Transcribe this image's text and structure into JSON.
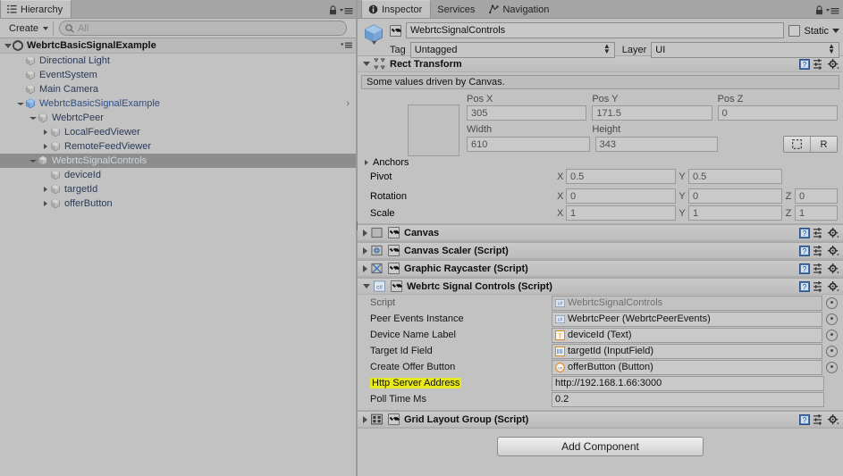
{
  "hierarchy": {
    "tab_label": "Hierarchy",
    "tab_icon": "hierarchy-icon",
    "lock_icon": "lock-icon",
    "menu_icon": "panel-menu-icon",
    "create_label": "Create",
    "search_placeholder": "All",
    "search_value": "",
    "search_icon": "search-icon",
    "scene_root": "WebrtcBasicSignalExample",
    "items": [
      {
        "label": "Directional Light",
        "indent": 1,
        "expander": "none",
        "icon": "gameobject-cube-icon",
        "state": "normal"
      },
      {
        "label": "EventSystem",
        "indent": 1,
        "expander": "none",
        "icon": "gameobject-cube-icon",
        "state": "normal"
      },
      {
        "label": "Main Camera",
        "indent": 1,
        "expander": "none",
        "icon": "gameobject-cube-icon",
        "state": "normal"
      },
      {
        "label": "WebrtcBasicSignalExample",
        "indent": 1,
        "expander": "open",
        "icon": "prefab-cube-icon",
        "state": "prefab"
      },
      {
        "label": "WebrtcPeer",
        "indent": 2,
        "expander": "open",
        "icon": "gameobject-cube-icon",
        "state": "normal"
      },
      {
        "label": "LocalFeedViewer",
        "indent": 3,
        "expander": "closed",
        "icon": "gameobject-cube-icon",
        "state": "normal"
      },
      {
        "label": "RemoteFeedViewer",
        "indent": 3,
        "expander": "closed",
        "icon": "gameobject-cube-icon",
        "state": "normal"
      },
      {
        "label": "WebrtcSignalControls",
        "indent": 2,
        "expander": "open",
        "icon": "gameobject-cube-icon",
        "state": "selected"
      },
      {
        "label": "deviceId",
        "indent": 3,
        "expander": "none",
        "icon": "gameobject-cube-icon",
        "state": "normal"
      },
      {
        "label": "targetId",
        "indent": 3,
        "expander": "closed",
        "icon": "gameobject-cube-icon",
        "state": "normal"
      },
      {
        "label": "offerButton",
        "indent": 3,
        "expander": "closed",
        "icon": "gameobject-cube-icon",
        "state": "normal"
      }
    ]
  },
  "inspector": {
    "tabs": [
      {
        "label": "Inspector",
        "icon": "info-circle-icon",
        "active": true
      },
      {
        "label": "Services",
        "icon": "none",
        "active": false
      },
      {
        "label": "Navigation",
        "icon": "navigation-icon",
        "active": false
      }
    ],
    "lock_icon": "lock-icon",
    "menu_icon": "panel-menu-icon",
    "object": {
      "enabled": true,
      "name": "WebrtcSignalControls",
      "static_label": "Static",
      "static_checked": false,
      "tag_label": "Tag",
      "tag_value": "Untagged",
      "layer_label": "Layer",
      "layer_value": "UI"
    },
    "rect_transform": {
      "title": "Rect Transform",
      "expanded": true,
      "icon": "rect-transform-icon",
      "help_text": "Some values driven by Canvas.",
      "col_headers": [
        "Pos X",
        "Pos Y",
        "Pos Z"
      ],
      "pos": [
        "305",
        "171.5",
        "0"
      ],
      "size_headers": [
        "Width",
        "Height"
      ],
      "size": [
        "610",
        "343"
      ],
      "blueprint_button": "blueprint-mode-icon",
      "raw_button": "R",
      "anchors_label": "Anchors",
      "pivot_label": "Pivot",
      "pivot": [
        "0.5",
        "0.5"
      ],
      "rotation_label": "Rotation",
      "rotation": [
        "0",
        "0",
        "0"
      ],
      "scale_label": "Scale",
      "scale": [
        "1",
        "1",
        "1"
      ],
      "axis_labels": [
        "X",
        "Y",
        "Z"
      ]
    },
    "components": [
      {
        "title": "Canvas",
        "enabled": true,
        "expanded": false,
        "icon": "canvas-icon"
      },
      {
        "title": "Canvas Scaler (Script)",
        "enabled": true,
        "expanded": false,
        "icon": "canvas-scaler-icon"
      },
      {
        "title": "Graphic Raycaster (Script)",
        "enabled": true,
        "expanded": false,
        "icon": "graphic-raycaster-icon"
      }
    ],
    "script_component": {
      "title": "Webrtc Signal Controls (Script)",
      "enabled": true,
      "expanded": true,
      "icon": "csharp-script-icon",
      "properties": [
        {
          "label": "Script",
          "value": "WebrtcSignalControls",
          "type": "object",
          "badge": "csharp-script-icon",
          "dim": true,
          "highlight": false
        },
        {
          "label": "Peer Events Instance",
          "value": "WebrtcPeer (WebrtcPeerEvents)",
          "type": "object",
          "badge": "csharp-script-icon",
          "dim": false,
          "highlight": false
        },
        {
          "label": "Device Name Label",
          "value": "deviceId (Text)",
          "type": "object",
          "badge": "text-icon",
          "dim": false,
          "highlight": false
        },
        {
          "label": "Target Id Field",
          "value": "targetId (InputField)",
          "type": "object",
          "badge": "inputfield-icon",
          "dim": false,
          "highlight": false
        },
        {
          "label": "Create Offer Button",
          "value": "offerButton (Button)",
          "type": "object",
          "badge": "button-icon",
          "dim": false,
          "highlight": false
        },
        {
          "label": "Http Server Address",
          "value": "http://192.168.1.66:3000",
          "type": "text",
          "badge": "none",
          "dim": false,
          "highlight": true
        },
        {
          "label": "Poll Time Ms",
          "value": "0.2",
          "type": "text",
          "badge": "none",
          "dim": false,
          "highlight": false
        }
      ]
    },
    "grid_layout": {
      "title": "Grid Layout Group (Script)",
      "enabled": true,
      "expanded": false,
      "icon": "grid-layout-icon"
    },
    "add_component_label": "Add Component"
  },
  "colors": {
    "panel_bg": "#c2c2c2",
    "tabbar_bg": "#a5a5a5",
    "selection": "#8d8d8d",
    "prefab_blue": "#2f4f86",
    "highlight_yellow": "#e8e81e",
    "field_bg": "#c9c9c9"
  }
}
